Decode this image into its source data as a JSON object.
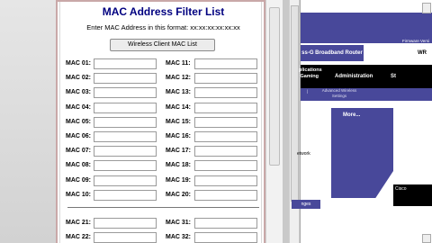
{
  "popup": {
    "title": "MAC Address Filter List",
    "format_hint": "Enter MAC Address in this format: xx:xx:xx:xx:xx:xx",
    "wireless_button": "Wireless Client MAC List",
    "left_labels": [
      "MAC 01:",
      "MAC 02:",
      "MAC 03:",
      "MAC 04:",
      "MAC 05:",
      "MAC 06:",
      "MAC 07:",
      "MAC 08:",
      "MAC 09:",
      "MAC 10:"
    ],
    "right_labels": [
      "MAC 11:",
      "MAC 12:",
      "MAC 13:",
      "MAC 14:",
      "MAC 15:",
      "MAC 16:",
      "MAC 17:",
      "MAC 18:",
      "MAC 19:",
      "MAC 20:"
    ],
    "bottom_left_labels": [
      "MAC 21:",
      "MAC 22:"
    ],
    "bottom_right_labels": [
      "MAC 31:",
      "MAC 32:"
    ]
  },
  "router_page": {
    "firmware": "Firmware Versi",
    "active_tab": "ss-G Broadband Router",
    "tab_vr": "WR",
    "nav_apps": "plications\n Gaming",
    "nav_admin": "Administration",
    "nav_status": "St",
    "nav_sep": "|",
    "nav_sub": "Advanced Wireless\nSettings",
    "more": "More...",
    "network": "etwork",
    "changes": "nges",
    "logo": "Cisco"
  }
}
